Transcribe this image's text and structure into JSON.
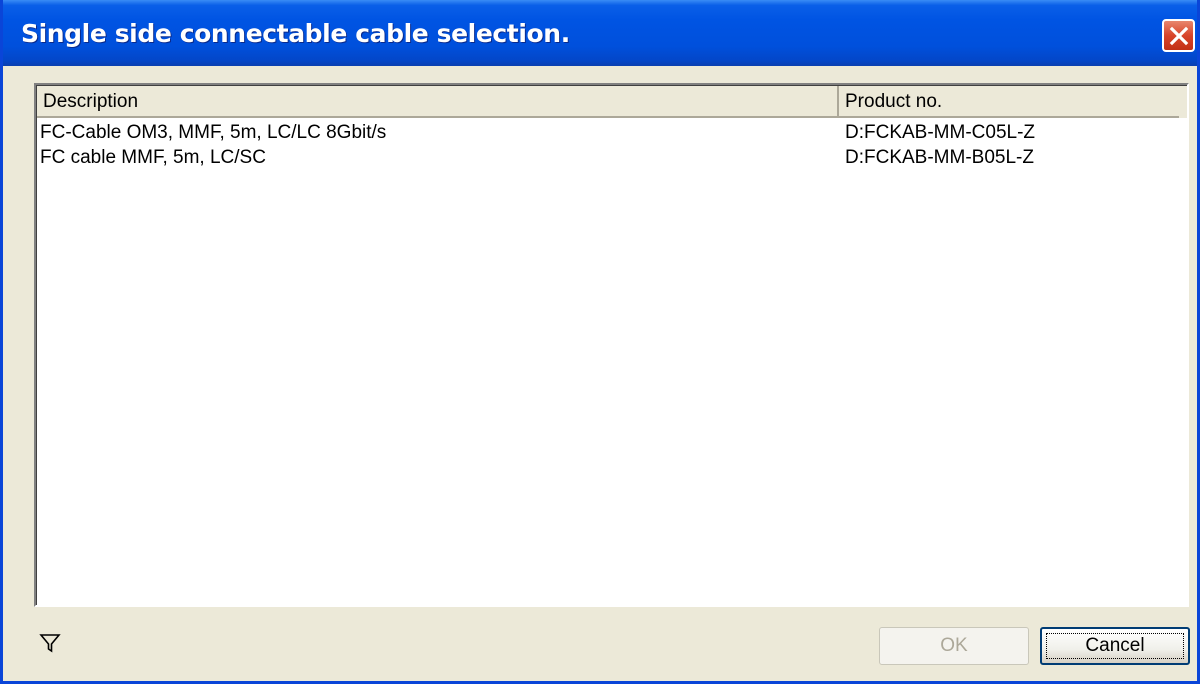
{
  "window": {
    "title": "Single side connectable cable selection."
  },
  "table": {
    "columns": [
      "Description",
      "Product no."
    ],
    "rows": [
      {
        "description": "FC-Cable OM3, MMF, 5m, LC/LC  8Gbit/s",
        "product_no": "D:FCKAB-MM-C05L-Z"
      },
      {
        "description": "FC cable MMF, 5m, LC/SC",
        "product_no": "D:FCKAB-MM-B05L-Z"
      }
    ]
  },
  "buttons": {
    "ok_label": "OK",
    "cancel_label": "Cancel"
  },
  "icons": {
    "close": "close-icon",
    "filter": "filter-icon"
  },
  "colors": {
    "titlebar": "#0054e3",
    "close_button": "#d8442a",
    "dialog_bg": "#ece9d8"
  }
}
